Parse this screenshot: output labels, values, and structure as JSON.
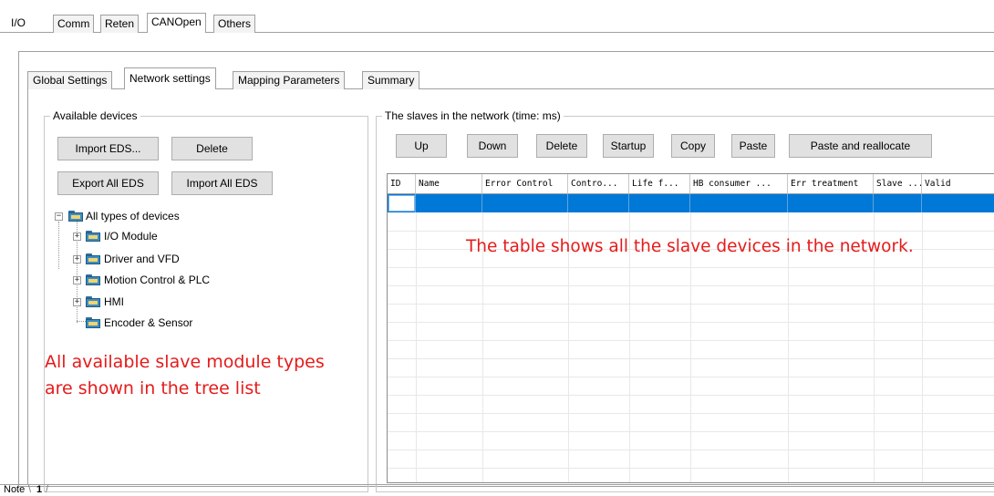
{
  "top_tabs": [
    "I/O",
    "Comm",
    "Reten",
    "CANOpen",
    "Others"
  ],
  "sub_tabs": [
    "Global Settings",
    "Network settings",
    "Mapping Parameters",
    "Summary"
  ],
  "available": {
    "legend": "Available devices",
    "buttons": {
      "import_eds": "Import EDS...",
      "delete": "Delete",
      "export_all": "Export All EDS",
      "import_all": "Import All EDS"
    },
    "tree": {
      "root": "All types of devices",
      "children": [
        "I/O Module",
        "Driver and VFD",
        "Motion Control & PLC",
        "HMI",
        "Encoder & Sensor"
      ]
    }
  },
  "slaves": {
    "legend": "The slaves in the network (time: ms)",
    "buttons": {
      "up": "Up",
      "down": "Down",
      "delete": "Delete",
      "startup": "Startup",
      "copy": "Copy",
      "paste": "Paste",
      "paste_realloc": "Paste and reallocate"
    },
    "columns": [
      "ID",
      "Name",
      "Error Control",
      "Contro...",
      "Life f...",
      "HB consumer ...",
      "Err treatment",
      "Slave ...",
      "Valid"
    ]
  },
  "annotations": {
    "table": "The table shows all the slave devices in the network.",
    "tree_line1": "All available slave module types",
    "tree_line2": "are shown in the tree list"
  },
  "bottom_tabs": [
    "Note",
    "1"
  ],
  "colors": {
    "selection": "#0078d7",
    "annotation": "#e51b1b"
  }
}
